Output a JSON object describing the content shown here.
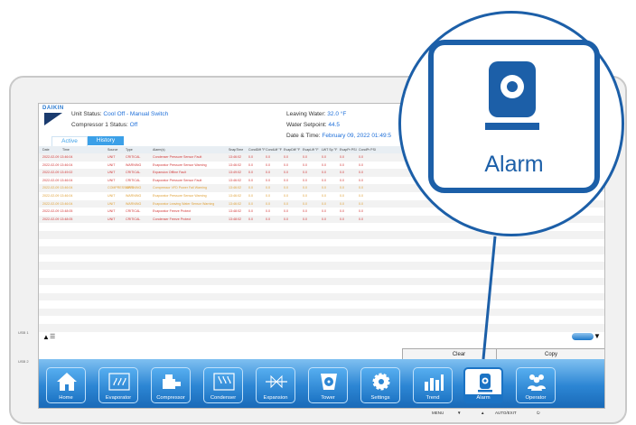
{
  "header": {
    "logo_text": "DAIKIN",
    "unit_status_label": "Unit Status:",
    "unit_status_value": "Cool Off - Manual Switch",
    "compressor_status_label": "Compressor 1 Status:",
    "compressor_status_value": "Off",
    "leaving_water_label": "Leaving Water:",
    "leaving_water_value": "32.0 °F",
    "water_setpoint_label": "Water Setpoint:",
    "water_setpoint_value": "44.5",
    "date_time_label": "Date & Time:",
    "date_time_value": "February 09, 2022  01:49:5"
  },
  "tabs": {
    "active": "Active",
    "history": "History"
  },
  "table": {
    "columns": [
      "Date",
      "Time",
      "Source",
      "Type",
      "Alarm(s)",
      "SnapTime",
      "CondDiff °F",
      "CondLiff °F",
      "EvapDiff °F",
      "EvapLiff °F",
      "LWT Sp °F",
      "EvapPr PSI",
      "CondPr PSI"
    ],
    "rows": [
      {
        "date": "2022-02-09 13:46:04",
        "source": "UNIT",
        "type": "CRITICAL",
        "alarm": "Condenser Pressure Sensor Fault",
        "snap": "13:46:02",
        "v": [
          "0.0",
          "0.0",
          "0.0",
          "0.0",
          "0.0",
          "0.0",
          "0.0"
        ],
        "level": "crit"
      },
      {
        "date": "2022-02-09 13:46:04",
        "source": "UNIT",
        "type": "WARNING",
        "alarm": "Evaporator Pressure Sensor Warning",
        "snap": "13:46:02",
        "v": [
          "0.0",
          "0.0",
          "0.0",
          "0.0",
          "0.0",
          "0.0",
          "0.0"
        ],
        "level": "crit"
      },
      {
        "date": "2022-02-09 13:49:02",
        "source": "UNIT",
        "type": "CRITICAL",
        "alarm": "Expansion Offline Fault",
        "snap": "13:49:02",
        "v": [
          "0.0",
          "0.0",
          "0.0",
          "0.0",
          "0.0",
          "0.0",
          "0.0"
        ],
        "level": "crit"
      },
      {
        "date": "2022-02-09 13:46:04",
        "source": "UNIT",
        "type": "CRITICAL",
        "alarm": "Evaporator Pressure Sensor Fault",
        "snap": "13:46:02",
        "v": [
          "0.0",
          "0.0",
          "0.0",
          "0.0",
          "0.0",
          "0.0",
          "0.0"
        ],
        "level": "crit"
      },
      {
        "date": "2022-02-09 13:46:04",
        "source": "COMPRESSOR 1",
        "type": "WARNING",
        "alarm": "Compressor VFD Power Fail Warning",
        "snap": "13:46:02",
        "v": [
          "0.0",
          "0.0",
          "0.0",
          "0.0",
          "0.0",
          "0.0",
          "0.0"
        ],
        "level": "warn"
      },
      {
        "date": "2022-02-09 13:46:04",
        "source": "UNIT",
        "type": "WARNING",
        "alarm": "Evaporator Pressure Sensor Warning",
        "snap": "13:46:02",
        "v": [
          "0.0",
          "0.0",
          "0.0",
          "0.0",
          "0.0",
          "0.0",
          "0.0"
        ],
        "level": "warn"
      },
      {
        "date": "2022-02-09 13:46:04",
        "source": "UNIT",
        "type": "WARNING",
        "alarm": "Evaporator Leaving Water Sensor Warning",
        "snap": "13:46:02",
        "v": [
          "0.0",
          "0.0",
          "0.0",
          "0.0",
          "0.0",
          "0.0",
          "0.0"
        ],
        "level": "warn"
      },
      {
        "date": "2022-02-09 13:48:05",
        "source": "UNIT",
        "type": "CRITICAL",
        "alarm": "Evaporator Freeze Protect",
        "snap": "13:48:02",
        "v": [
          "0.0",
          "0.0",
          "0.0",
          "0.0",
          "0.0",
          "0.0",
          "0.0"
        ],
        "level": "crit"
      },
      {
        "date": "2022-02-09 13:48:05",
        "source": "UNIT",
        "type": "CRITICAL",
        "alarm": "Condenser Freeze Protect",
        "snap": "13:48:02",
        "v": [
          "0.0",
          "0.0",
          "0.0",
          "0.0",
          "0.0",
          "0.0",
          "0.0"
        ],
        "level": "crit"
      }
    ]
  },
  "actions": {
    "clear": "Clear",
    "copy": "Copy"
  },
  "nav": [
    "Home",
    "Evaporator",
    "Compressor",
    "Condenser",
    "Expansion",
    "Tower",
    "Settings",
    "Trend",
    "Alarm",
    "Operator"
  ],
  "hardware": {
    "menu": "MENU",
    "down": "▼",
    "up": "▲",
    "auto_exit": "AUTO/EXIT",
    "power": "⏻",
    "usb1": "USB 1",
    "usb2": "USB 2"
  },
  "zoom": {
    "label": "Alarm"
  },
  "colors": {
    "accent": "#1c5fa8",
    "critical": "#d23a3a",
    "warning": "#e0a23a"
  }
}
